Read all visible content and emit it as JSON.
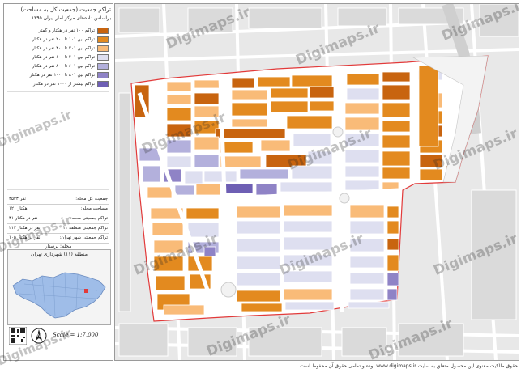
{
  "sidebar": {
    "title_line1": "تراکم جمعیت (جمعیت کل به مساحت)",
    "title_line2": "براساس داده‌های مرکز آمار ایران ۱۳۹۵",
    "legend": [
      {
        "label": "تراکم ۱۰۰ نفر در هکتار و کمتر",
        "color": "#c8640f"
      },
      {
        "label": "تراکم بین ۱۰۱ تا ۲۰۰ نفر در هکتار",
        "color": "#e38a1f"
      },
      {
        "label": "تراکم بین ۲۰۱ تا ۴۰۰ نفر در هکتار",
        "color": "#f9bb78"
      },
      {
        "label": "تراکم بین ۴۰۱ تا ۶۰۰ نفر در هکتار",
        "color": "#dedff0"
      },
      {
        "label": "تراکم بین ۶۰۱ تا ۸۰۰ نفر در هکتار",
        "color": "#b3b0dc"
      },
      {
        "label": "تراکم بین ۸۰۱ تا ۱۰۰۰ نفر در هکتار",
        "color": "#8f83c6"
      },
      {
        "label": "تراکم بیشتر از ۱۰۰۰ نفر در هکتار",
        "color": "#6e5fb4"
      }
    ],
    "stats": [
      {
        "label": "جمعیت کل محله:",
        "value": "۴۵۳۳ نفر"
      },
      {
        "label": "مساحت محله:",
        "value": "۱۲۰ هکتار"
      },
      {
        "label": "تراکم جمعیتی محله:",
        "value": "۳۱ نفر در هکتار"
      },
      {
        "label": "تراکم جمعیتی منطقه ۱۱:",
        "value": "۲۱۳ نفر در هکتار"
      },
      {
        "label": "تراکم جمعیتی شهر تهران:",
        "value": "۱۰۵ نفر در هکتار"
      }
    ],
    "neighborhood": "محله: پرستار",
    "district": "منطقه (۱۱) شهرداری تهران",
    "scale": "Scale = 1:7,000"
  },
  "footer": "حقوق مالکیت معنوی این محصول متعلق به سایت www.digimaps.ir بوده و تمامی حقوق آن محفوظ است",
  "watermark": "Digimaps.ir",
  "colors": {
    "d1": "#c8640f",
    "d2": "#e38a1f",
    "d3": "#f9bb78",
    "d4": "#dedff0",
    "d5": "#b3b0dc",
    "d6": "#8f83c6",
    "d7": "#6e5fb4",
    "boundary": "#e23a3a",
    "background": "#e9e9e9"
  }
}
